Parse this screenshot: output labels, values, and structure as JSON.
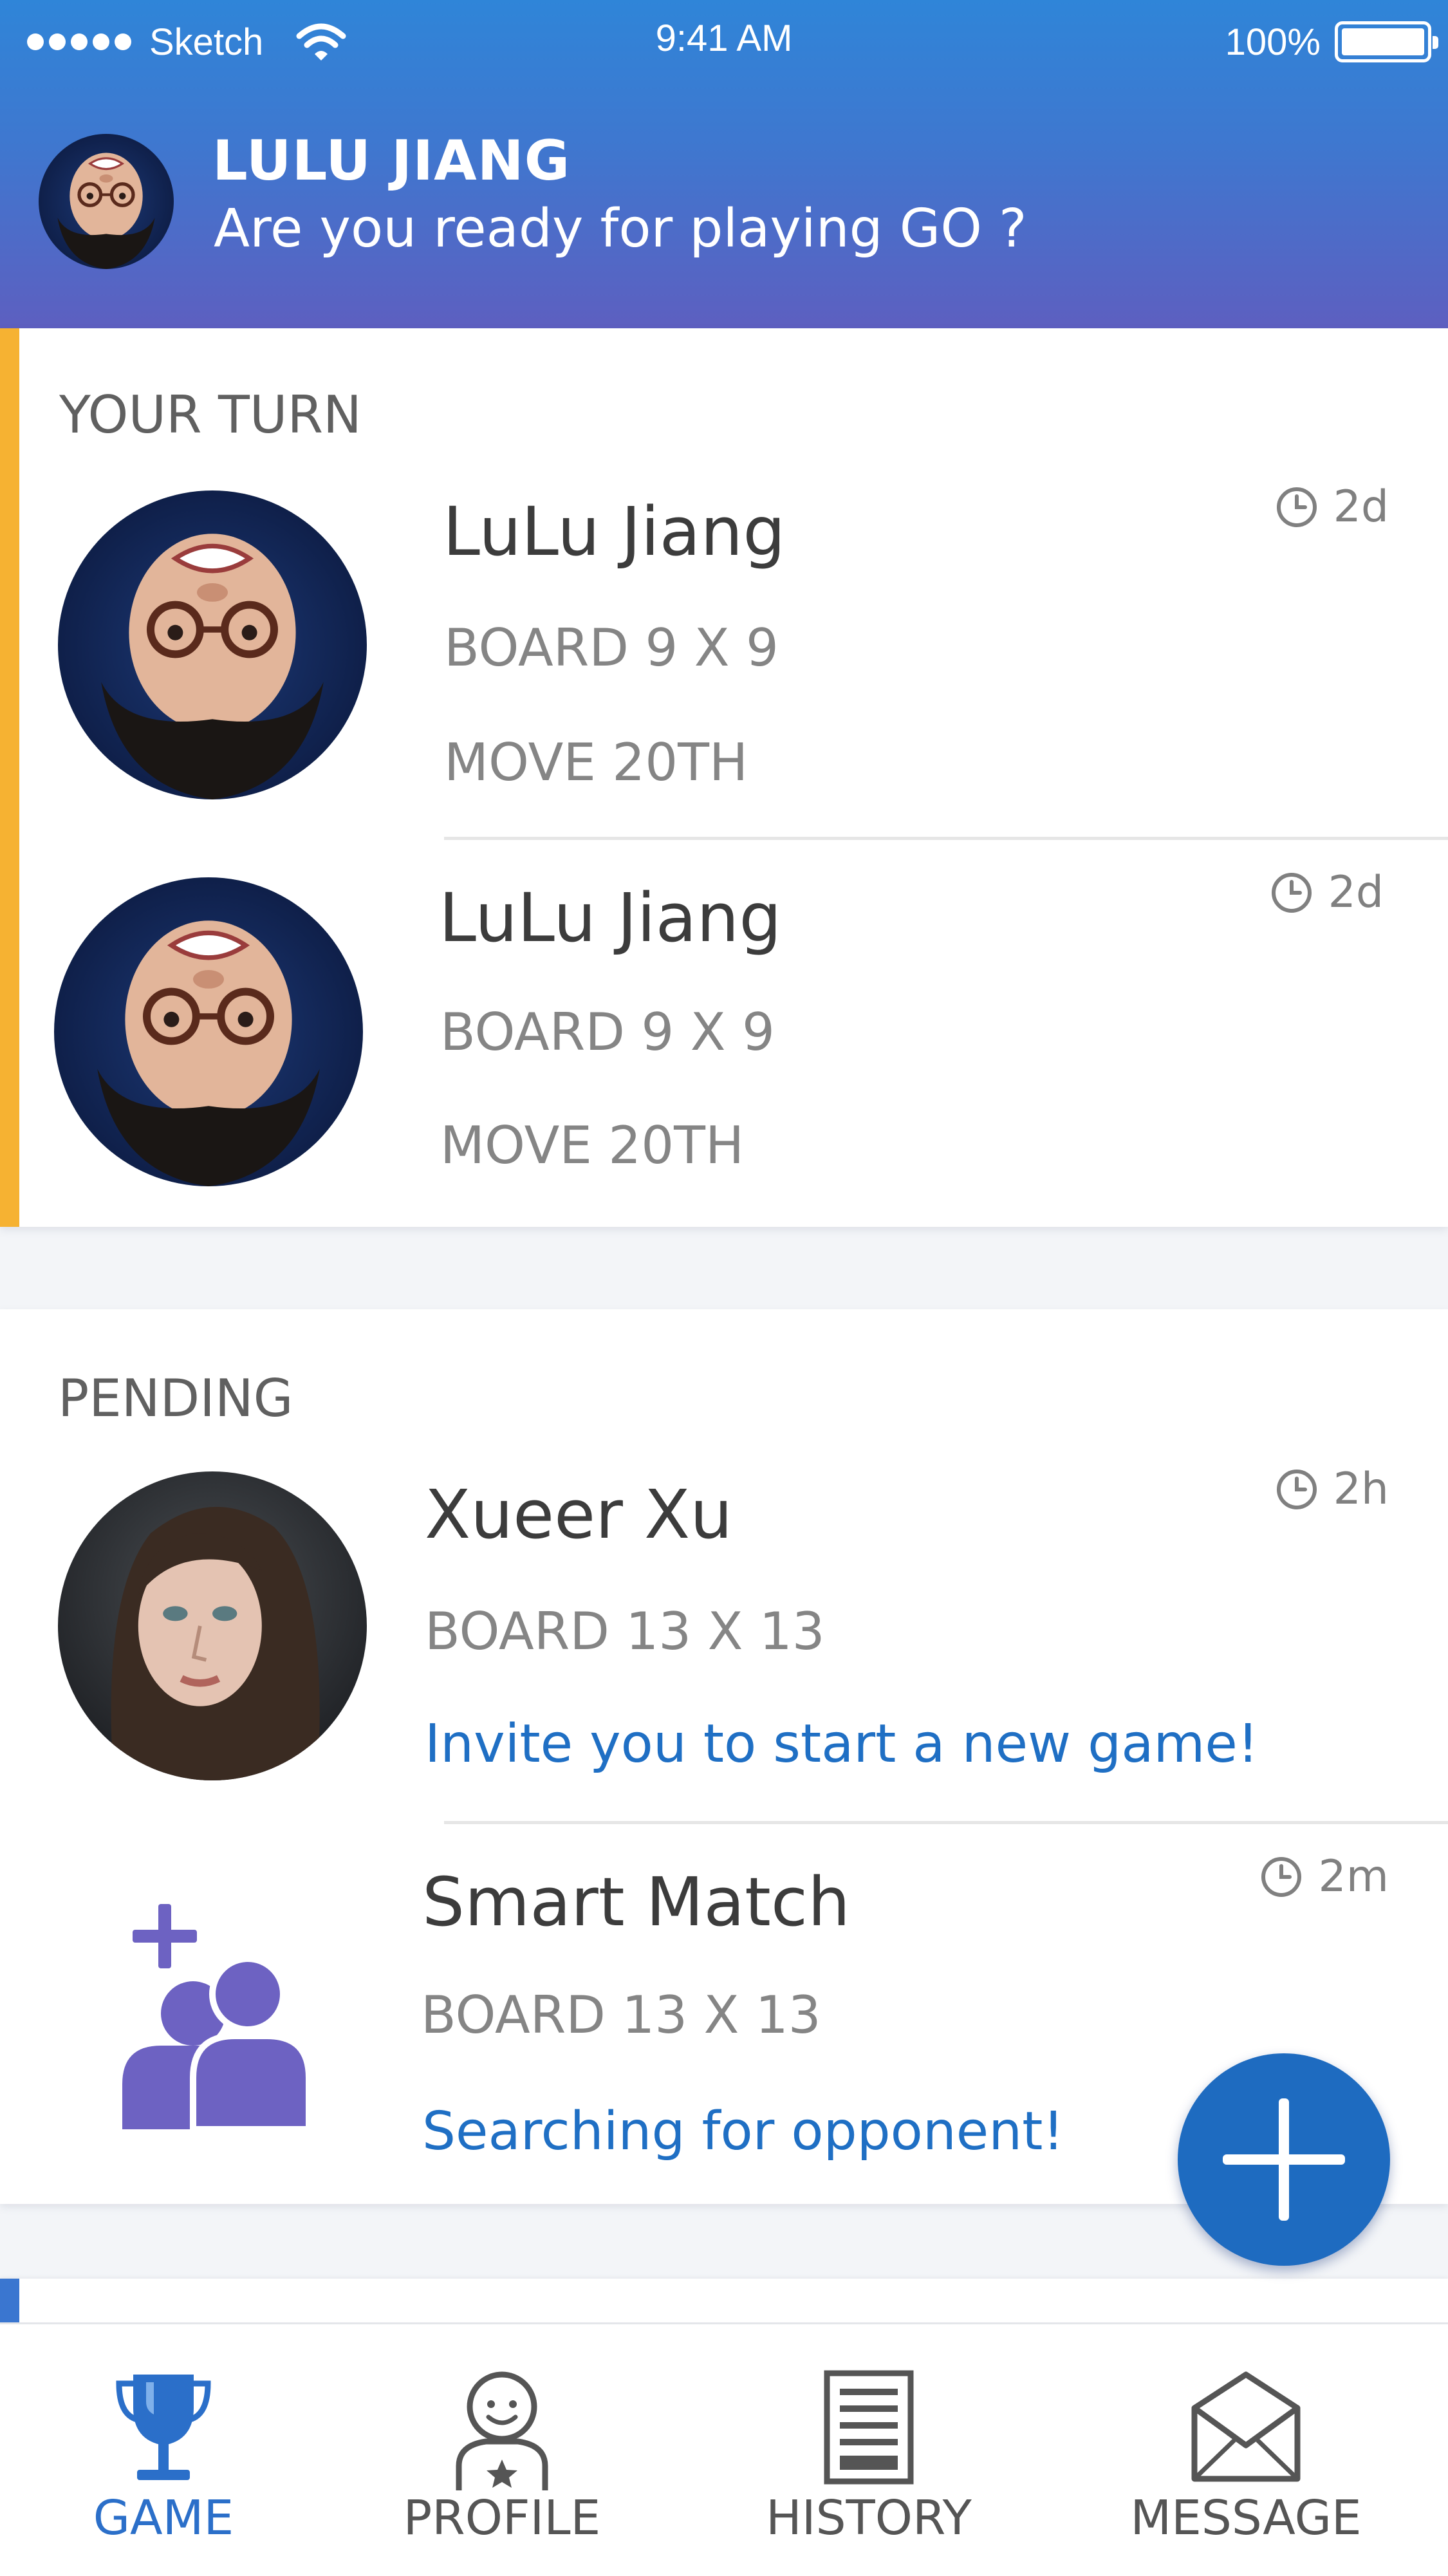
{
  "status_bar": {
    "carrier": "Sketch",
    "time": "9:41 AM",
    "battery": "100%"
  },
  "header": {
    "user_name": "LULU JIANG",
    "tagline": "Are you ready for playing GO ?"
  },
  "your_turn": {
    "label": "YOUR TURN",
    "games": [
      {
        "name": "LuLu Jiang",
        "board": "BOARD 9 X 9",
        "move": "MOVE 20TH",
        "time": "2d"
      },
      {
        "name": "LuLu Jiang",
        "board": "BOARD 9 X 9",
        "move": "MOVE 20TH",
        "time": "2d"
      }
    ]
  },
  "pending": {
    "label": "PENDING",
    "games": [
      {
        "name": "Xueer Xu",
        "board": "BOARD 13 X 13",
        "status": "Invite you to start a new game!",
        "time": "2h"
      },
      {
        "name": "Smart Match",
        "board": "BOARD 13 X 13",
        "status": "Searching for opponent!",
        "time": "2m"
      }
    ]
  },
  "tabs": [
    {
      "label": "GAME",
      "icon": "trophy-icon",
      "active": true
    },
    {
      "label": "PROFILE",
      "icon": "profile-icon",
      "active": false
    },
    {
      "label": "HISTORY",
      "icon": "history-icon",
      "active": false
    },
    {
      "label": "MESSAGE",
      "icon": "message-icon",
      "active": false
    }
  ],
  "colors": {
    "header_top": "#2f85d8",
    "header_bottom": "#5d5fc0",
    "your_turn_accent": "#f6b232",
    "highlight_text": "#1f6fc4",
    "fab": "#1e6bc0",
    "active_tab": "#2b6fc9",
    "smart_match_icon": "#6d62c2"
  }
}
